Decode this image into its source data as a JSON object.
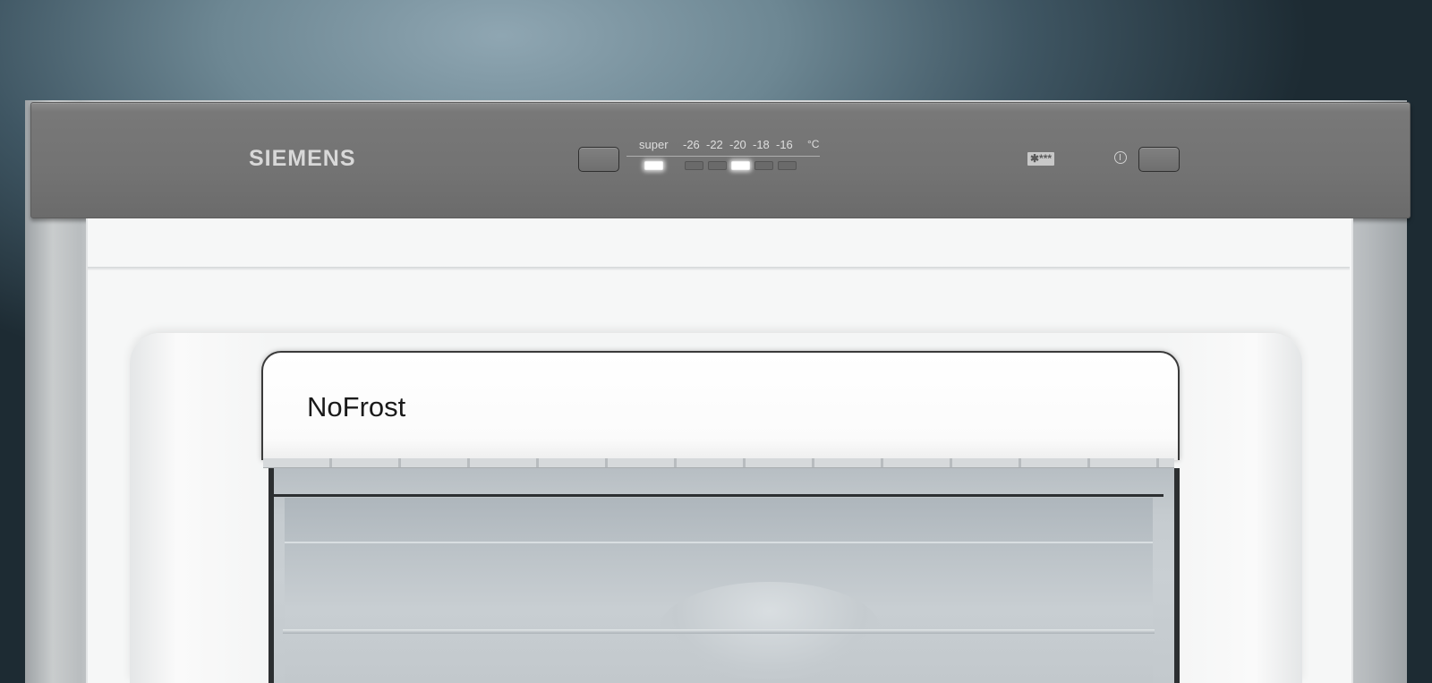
{
  "brand": "SIEMENS",
  "control_panel": {
    "super_label": "super",
    "temperatures": [
      "-26",
      "-22",
      "-20",
      "-18",
      "-16"
    ],
    "unit": "°C",
    "active_setting": "-20",
    "super_led_on": true,
    "rating_label": "✱***"
  },
  "drawer": {
    "label": "NoFrost"
  },
  "colors": {
    "panel": "#767676",
    "led_on": "#ffffff",
    "interior": "#f6f7f7"
  }
}
